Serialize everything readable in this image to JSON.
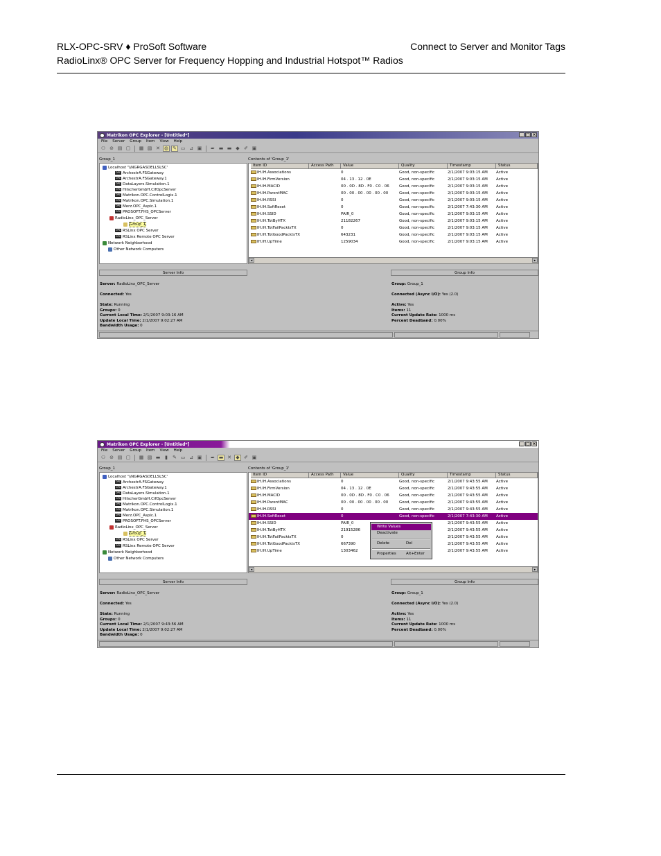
{
  "doc_header": {
    "left_line1": "RLX-OPC-SRV ♦ ProSoft Software",
    "right_line1": "Connect to Server and Monitor Tags",
    "line2": "RadioLinx® OPC Server for Frequency Hopping and Industrial Hotspot™ Radios"
  },
  "window1": {
    "title": "Matrikon OPC Explorer - [Untitled*]",
    "menu": [
      "File",
      "Server",
      "Group",
      "Item",
      "View",
      "Help"
    ],
    "left_header": "Group_1",
    "right_header": "Contents of 'Group_1'",
    "tree": [
      "Localhost '\\\\NGRGASDELLSLSC'",
      "ArchestrA.FSGateway",
      "ArchestrA.FSGateway.1",
      "DataLayers.Simulation.1",
      "HilscherGmbH.CifOpcServer",
      "Matrikon.OPC.ControlLogix.1",
      "Matrikon.OPC.Simulation.1",
      "Merz.OPC_Aspic.1",
      "PROSOFT.FHS_OPCServer",
      "RadioLinx_OPC_Server",
      "Group_1",
      "RSLinx OPC Server",
      "RSLinx Remote OPC Server",
      "Network Neighborhood",
      "Other Network Computers"
    ],
    "columns": [
      "Item ID",
      "Access Path",
      "Value",
      "Quality",
      "Timestamp",
      "Status"
    ],
    "rows": [
      {
        "id": "IH.IH.Associations",
        "value": "0",
        "quality": "Good, non-specific",
        "ts": "2/1/2007 9:03:15 AM",
        "status": "Active"
      },
      {
        "id": "IH.IH.FirmVersion",
        "value": "04 . 13 . 12 . 0E",
        "quality": "Good, non-specific",
        "ts": "2/1/2007 9:03:15 AM",
        "status": "Active"
      },
      {
        "id": "IH.IH.MACID",
        "value": "00 . 0D . 8D . F0 . C0 . 06",
        "quality": "Good, non-specific",
        "ts": "2/1/2007 9:03:15 AM",
        "status": "Active"
      },
      {
        "id": "IH.IH.ParentMAC",
        "value": "00 . 00 . 00 . 00 . 00 . 00",
        "quality": "Good, non-specific",
        "ts": "2/1/2007 9:03:15 AM",
        "status": "Active"
      },
      {
        "id": "IH.IH.RSSI",
        "value": "0",
        "quality": "Good, non-specific",
        "ts": "2/1/2007 9:03:15 AM",
        "status": "Active"
      },
      {
        "id": "IH.IH.SoftReset",
        "value": "0",
        "quality": "Good, non-specific",
        "ts": "2/1/2007 7:43:30 AM",
        "status": "Active"
      },
      {
        "id": "IH.IH.SSID",
        "value": "PAIR_0",
        "quality": "Good, non-specific",
        "ts": "2/1/2007 9:03:15 AM",
        "status": "Active"
      },
      {
        "id": "IH.IH.TotByHTX",
        "value": "21182267",
        "quality": "Good, non-specific",
        "ts": "2/1/2007 9:03:15 AM",
        "status": "Active"
      },
      {
        "id": "IH.IH.TotFailPacktsTX",
        "value": "0",
        "quality": "Good, non-specific",
        "ts": "2/1/2007 9:03:15 AM",
        "status": "Active"
      },
      {
        "id": "IH.IH.TotGoodPacktsTX",
        "value": "643231",
        "quality": "Good, non-specific",
        "ts": "2/1/2007 9:03:15 AM",
        "status": "Active"
      },
      {
        "id": "IH.IH.UpTime",
        "value": "1259034",
        "quality": "Good, non-specific",
        "ts": "2/1/2007 9:03:15 AM",
        "status": "Active"
      }
    ],
    "server_info_title": "Server Info",
    "group_info_title": "Group Info",
    "server_info": [
      {
        "k": "Server:",
        "v": " RadioLinx_OPC_Server"
      },
      {
        "k": "Connected:",
        "v": " Yes"
      },
      {
        "k": "State:",
        "v": " Running"
      },
      {
        "k": "Groups:",
        "v": " 0"
      },
      {
        "k": "Current Local Time:",
        "v": " 2/1/2007 9:03:16 AM"
      },
      {
        "k": "Update Local Time:",
        "v": " 2/1/2007 9:02:27 AM"
      },
      {
        "k": "Bandwidth Usage:",
        "v": " 0"
      }
    ],
    "group_info": [
      {
        "k": "Group:",
        "v": " Group_1"
      },
      {
        "k": "Connected (Async I/O):",
        "v": " Yes (2.0)"
      },
      {
        "k": "Active:",
        "v": " Yes"
      },
      {
        "k": "Items:",
        "v": " 11"
      },
      {
        "k": "Current Update Rate:",
        "v": " 1000 ms"
      },
      {
        "k": "Percent Deadband:",
        "v": " 0.00%"
      }
    ]
  },
  "window2": {
    "title": "Matrikon OPC Explorer - [Untitled*]",
    "menu": [
      "File",
      "Server",
      "Group",
      "Item",
      "View",
      "Help"
    ],
    "left_header": "Group_1",
    "right_header": "Contents of 'Group_1'",
    "tree": [
      "Localhost '\\\\NGRGASDELLSLSC'",
      "ArchestrA.FSGateway",
      "ArchestrA.FSGateway.1",
      "DataLayers.Simulation.1",
      "HilscherGmbH.CifOpcServer",
      "Matrikon.OPC.ControlLogix.1",
      "Matrikon.OPC.Simulation.1",
      "Merz.OPC_Aspic.1",
      "PROSOFT.FHS_OPCServer",
      "RadioLinx_OPC_Server",
      "Group_1",
      "RSLinx OPC Server",
      "RSLinx Remote OPC Server",
      "Network Neighborhood",
      "Other Network Computers"
    ],
    "columns": [
      "Item ID",
      "Access Path",
      "Value",
      "Quality",
      "Timestamp",
      "Status"
    ],
    "rows": [
      {
        "id": "IH.IH.Associations",
        "value": "0",
        "quality": "Good, non-specific",
        "ts": "2/1/2007 9:43:55 AM",
        "status": "Active"
      },
      {
        "id": "IH.IH.FirmVersion",
        "value": "04 . 13 . 12 . 0E",
        "quality": "Good, non-specific",
        "ts": "2/1/2007 9:43:55 AM",
        "status": "Active"
      },
      {
        "id": "IH.IH.MACID",
        "value": "00 . 0D . 8D . F0 . C0 . 06",
        "quality": "Good, non-specific",
        "ts": "2/1/2007 9:43:55 AM",
        "status": "Active"
      },
      {
        "id": "IH.IH.ParentMAC",
        "value": "00 . 00 . 00 . 00 . 00 . 00",
        "quality": "Good, non-specific",
        "ts": "2/1/2007 9:43:55 AM",
        "status": "Active"
      },
      {
        "id": "IH.IH.RSSI",
        "value": "0",
        "quality": "Good, non-specific",
        "ts": "2/1/2007 9:43:55 AM",
        "status": "Active"
      },
      {
        "id": "IH.IH.SoftReset",
        "value": "0",
        "quality": "Good, non-specific",
        "ts": "2/1/2007 7:43:30 AM",
        "status": "Active"
      },
      {
        "id": "IH.IH.SSID",
        "value": "PAIR_0",
        "quality": "c",
        "ts": "2/1/2007 9:43:55 AM",
        "status": "Active"
      },
      {
        "id": "IH.IH.TotByHTX",
        "value": "21915286",
        "quality": "c",
        "ts": "2/1/2007 9:43:55 AM",
        "status": "Active"
      },
      {
        "id": "IH.IH.TotFailPacktsTX",
        "value": "0",
        "quality": "c",
        "ts": "2/1/2007 9:43:55 AM",
        "status": "Active"
      },
      {
        "id": "IH.IH.TotGoodPacktsTX",
        "value": "667390",
        "quality": "c",
        "ts": "2/1/2007 9:43:55 AM",
        "status": "Active"
      },
      {
        "id": "IH.IH.UpTime",
        "value": "1303462",
        "quality": "c",
        "ts": "2/1/2007 9:43:55 AM",
        "status": "Active"
      }
    ],
    "selected_row": 5,
    "context_menu": {
      "write": "Write Values",
      "deactivate": "Deactivate",
      "delete": "Delete",
      "delete_key": "Del",
      "properties": "Properties",
      "properties_key": "Alt+Enter"
    },
    "server_info_title": "Server Info",
    "group_info_title": "Group Info",
    "server_info": [
      {
        "k": "Server:",
        "v": " RadioLinx_OPC_Server"
      },
      {
        "k": "Connected:",
        "v": " Yes"
      },
      {
        "k": "State:",
        "v": " Running"
      },
      {
        "k": "Groups:",
        "v": " 0"
      },
      {
        "k": "Current Local Time:",
        "v": " 2/1/2007 9:43:56 AM"
      },
      {
        "k": "Update Local Time:",
        "v": " 2/1/2007 9:02:27 AM"
      },
      {
        "k": "Bandwidth Usage:",
        "v": " 0"
      }
    ],
    "group_info": [
      {
        "k": "Group:",
        "v": " Group_1"
      },
      {
        "k": "Connected (Async I/O):",
        "v": " Yes (2.0)"
      },
      {
        "k": "Active:",
        "v": " Yes"
      },
      {
        "k": "Items:",
        "v": " 11"
      },
      {
        "k": "Current Update Rate:",
        "v": " 1000 ms"
      },
      {
        "k": "Percent Deadband:",
        "v": " 0.00%"
      }
    ]
  },
  "toolbar_icons": [
    "new-icon",
    "open-icon",
    "save-icon",
    "refresh-icon",
    "add-group-icon",
    "add-item-icon",
    "properties-icon",
    "delete-icon",
    "read-icon",
    "write-icon"
  ]
}
